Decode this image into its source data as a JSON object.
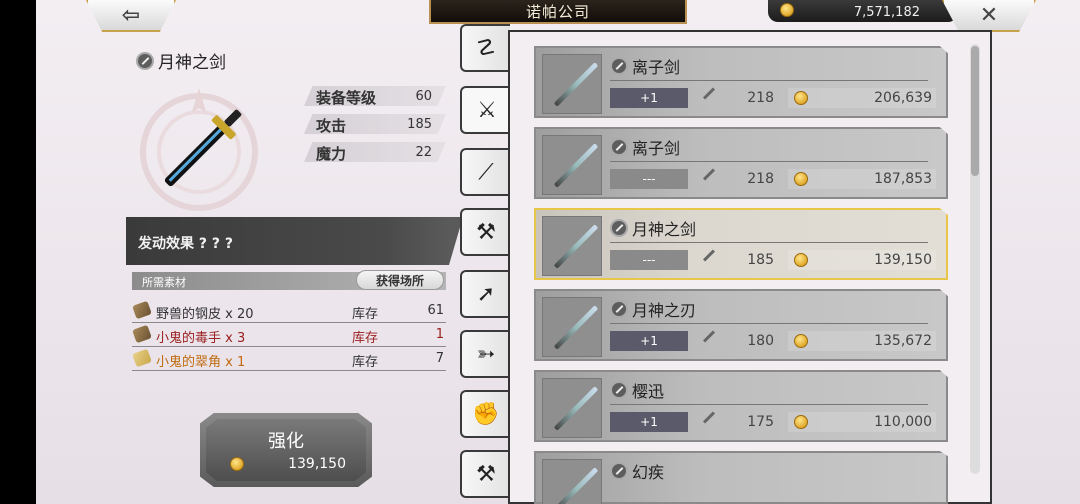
{
  "header": {
    "title": "诺帕公司",
    "gold": "7,571,182",
    "back_symbol": "⇦",
    "close_symbol": "✕"
  },
  "item": {
    "name": "月神之剑",
    "stats": [
      {
        "label": "装备等级",
        "value": "60"
      },
      {
        "label": "攻击",
        "value": "185"
      },
      {
        "label": "魔力",
        "value": "22"
      }
    ],
    "effect": "发动效果 ? ? ?"
  },
  "materials": {
    "header": "所需素材",
    "source_button": "获得场所",
    "rows": [
      {
        "name": "野兽的钢皮 x 20",
        "stock_label": "库存",
        "qty": "61",
        "color": "#333333"
      },
      {
        "name": "小鬼的毒手 x 3",
        "stock_label": "库存",
        "qty": "1",
        "color": "#9b2020"
      },
      {
        "name": "小鬼的翠角 x 1",
        "stock_label": "库存",
        "qty": "7",
        "color": "#c06a10"
      }
    ]
  },
  "enhance": {
    "label": "强化",
    "cost": "139,150"
  },
  "tabs": [
    {
      "icon": "staff-icon",
      "glyph": "☡"
    },
    {
      "icon": "sword-icon",
      "glyph": "⚔"
    },
    {
      "icon": "curved-blade-icon",
      "glyph": "⟋"
    },
    {
      "icon": "axe-icon",
      "glyph": "⚒"
    },
    {
      "icon": "spear-icon",
      "glyph": "➚"
    },
    {
      "icon": "bow-icon",
      "glyph": "➳"
    },
    {
      "icon": "fist-icon",
      "glyph": "✊"
    },
    {
      "icon": "hammer-icon",
      "glyph": "⚒"
    }
  ],
  "shop_items": [
    {
      "name": "离子剑",
      "level": "+1",
      "atk": "218",
      "price": "206,639"
    },
    {
      "name": "离子剑",
      "level": "---",
      "atk": "218",
      "price": "187,853"
    },
    {
      "name": "月神之剑",
      "level": "---",
      "atk": "185",
      "price": "139,150"
    },
    {
      "name": "月神之刃",
      "level": "+1",
      "atk": "180",
      "price": "135,672"
    },
    {
      "name": "樱迅",
      "level": "+1",
      "atk": "175",
      "price": "110,000"
    },
    {
      "name": "幻疾",
      "level": "",
      "atk": "",
      "price": ""
    }
  ]
}
